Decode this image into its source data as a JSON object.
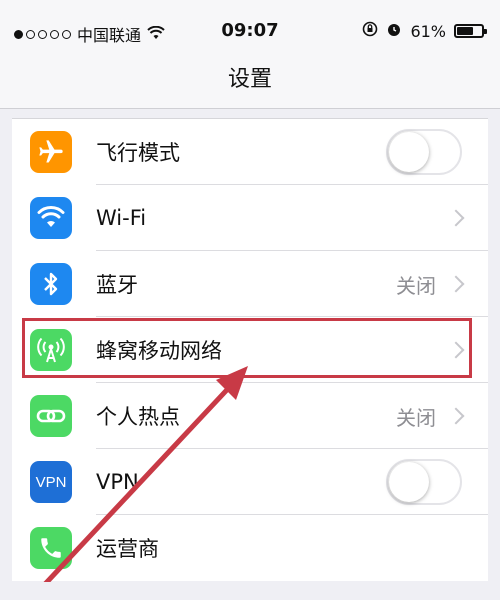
{
  "status_bar": {
    "carrier": "中国联通",
    "time": "09:07",
    "battery": "61%",
    "battery_level": 0.61,
    "signal_filled": 1,
    "signal_total": 5
  },
  "nav": {
    "title": "设置"
  },
  "settings": [
    {
      "label": "飞行模式",
      "icon": "airplane-icon",
      "color": "#ff9500",
      "accessory": "toggle",
      "value": "off"
    },
    {
      "label": "Wi-Fi",
      "icon": "wifi-icon",
      "color": "#1e88f0",
      "accessory": "chevron"
    },
    {
      "label": "蓝牙",
      "icon": "bluetooth-icon",
      "color": "#1e88f0",
      "accessory": "chevron",
      "detail": "关闭"
    },
    {
      "label": "蜂窝移动网络",
      "icon": "cellular-icon",
      "color": "#4cd964",
      "accessory": "chevron"
    },
    {
      "label": "个人热点",
      "icon": "hotspot-icon",
      "color": "#4cd964",
      "accessory": "chevron",
      "detail": "关闭"
    },
    {
      "label": "VPN",
      "icon": "vpn-icon",
      "icon_text": "VPN",
      "color": "#1e6fd6",
      "accessory": "toggle",
      "value": "off"
    },
    {
      "label": "运营商",
      "icon": "phone-icon",
      "color": "#4cd964",
      "accessory": "none"
    }
  ],
  "annotation": {
    "highlight_color": "#c83a46",
    "target_label": "蜂窝移动网络"
  }
}
